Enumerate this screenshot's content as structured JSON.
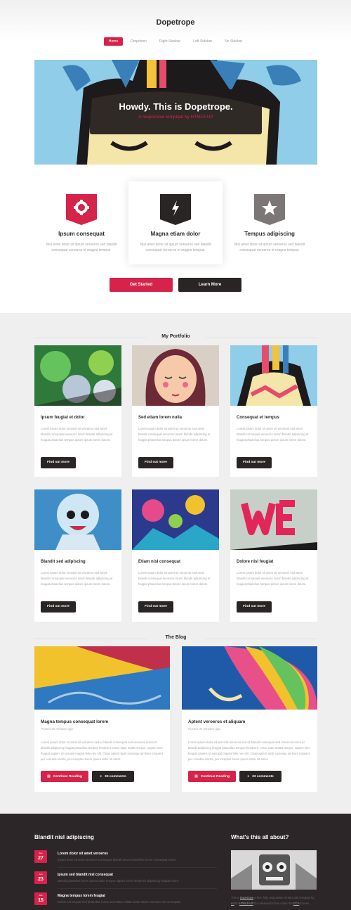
{
  "site": {
    "logo": "Dopetrope"
  },
  "nav": [
    {
      "label": "Home",
      "active": true
    },
    {
      "label": "Dropdown",
      "active": false
    },
    {
      "label": "Right Sidebar",
      "active": false
    },
    {
      "label": "Left Sidebar",
      "active": false
    },
    {
      "label": "No Sidebar",
      "active": false
    }
  ],
  "banner": {
    "title": "Howdy. This is Dopetrope.",
    "subtitle": "A responsive template by HTML5 UP"
  },
  "features": [
    {
      "icon": "gear-icon",
      "color": "#d52349",
      "title": "Ipsum consequat",
      "text": "Nisl amet dolor sit ipsum veroeros sed blandit consequat veroeros et magna tempus."
    },
    {
      "icon": "bolt-icon",
      "color": "#2a2525",
      "title": "Magna etiam dolor",
      "text": "Nisl amet dolor sit ipsum veroeros sed blandit consequat veroeros et magna tempus."
    },
    {
      "icon": "star-icon",
      "color": "#7d7677",
      "title": "Tempus adipiscing",
      "text": "Nisl amet dolor sit ipsum veroeros sed blandit consequat veroeros et magna tempus."
    }
  ],
  "buttons": {
    "primary": "Get Started",
    "secondary": "Learn More"
  },
  "portfolio": {
    "heading": "My Portfolio",
    "items": [
      {
        "title": "Ipsum feugiat et dolor",
        "text": "Lorem ipsum dolor sit amet sit veroeros sed amet blandit consequat veroeros lorem blandit adipiscing et feugiat phasellus tempus dolore ipsum lorem dolore.",
        "button": "Find out more"
      },
      {
        "title": "Sed etiam lorem nulla",
        "text": "Lorem ipsum dolor sit amet sit veroeros sed amet blandit consequat veroeros lorem blandit adipiscing et feugiat phasellus tempus dolore ipsum lorem dolore.",
        "button": "Find out more"
      },
      {
        "title": "Consequat et tempus",
        "text": "Lorem ipsum dolor sit amet sit veroeros sed amet blandit consequat veroeros lorem blandit adipiscing et feugiat phasellus tempus dolore ipsum lorem dolore.",
        "button": "Find out more"
      },
      {
        "title": "Blandit sed adipiscing",
        "text": "Lorem ipsum dolor sit amet sit veroeros sed amet blandit consequat veroeros lorem blandit adipiscing et feugiat phasellus tempus dolore ipsum lorem dolore.",
        "button": "Find out more"
      },
      {
        "title": "Etiam nisl consequat",
        "text": "Lorem ipsum dolor sit amet sit veroeros sed amet blandit consequat veroeros lorem blandit adipiscing et feugiat phasellus tempus dolore ipsum lorem dolore.",
        "button": "Find out more"
      },
      {
        "title": "Dolore nisl feugiat",
        "text": "Lorem ipsum dolor sit amet sit veroeros sed amet blandit consequat veroeros lorem blandit adipiscing et feugiat phasellus tempus dolore ipsum lorem dolore.",
        "button": "Find out more"
      }
    ]
  },
  "blog": {
    "heading": "The Blog",
    "posts": [
      {
        "title": "Magna tempus consequat lorem",
        "meta": "Posted 45 minutes ago",
        "text": "Lorem ipsum dolor sit amet sit veroeros sed et blandit consequat sed veroeros lorem et blandit adipiscing feugiat phasellus tempus hendrerit, tortor vitae mattis tempor, sapien sem feugiat sapien, id suscipit magna felis nec elit. Class aptent taciti sociosqu ad litora torquent per conubia nostra, per inceptos lorem ipsum dolor sit amet.",
        "read": "Continue Reading",
        "comments": "33 comments"
      },
      {
        "title": "Aptent veroeros et aliquam",
        "meta": "Posted 45 minutes ago",
        "text": "Lorem ipsum dolor sit amet sit veroeros sed et blandit consequat sed veroeros lorem et blandit adipiscing feugiat phasellus tempus hendrerit, tortor vitae mattis tempor, sapien sem feugiat sapien, id suscipit magna felis nec elit. Class aptent taciti sociosqu ad litora torquent per conubia nostra, per inceptos lorem ipsum dolor sit amet.",
        "read": "Continue Reading",
        "comments": "33 comments"
      }
    ]
  },
  "footer": {
    "left_title": "Blandit nisl adipiscing",
    "items": [
      {
        "month": "Jan",
        "day": "27",
        "title": "Lorem dolor sit amet veroeros",
        "text": "Ipsum dolor sit amet veroeros consequat blandit ipsum phasellus lorem consequat etiam."
      },
      {
        "month": "Jan",
        "day": "23",
        "title": "Ipsum sed blandit nisl consequat",
        "text": "Blandit phasellus lorem ipsum dolor tempor sapien tortor hendrerit adipiscing feugiat lorem."
      },
      {
        "month": "Jan",
        "day": "15",
        "title": "Magna tempus lorem feugiat",
        "text": "Dolore consequat sed phasellus lorem sed etiam nullam dolor etiam sed amet sit consequat."
      }
    ],
    "right_title": "What's this all about?",
    "about": {
      "pre": "This is ",
      "link1": "Dopetrope",
      "mid1": " a free, fully responsive HTML5 site template by ",
      "link2": "AJ",
      "mid2": " for ",
      "link3": "HTML5 UP",
      "mid3": " It's released for free under the ",
      "link4": "CCA",
      "post": " license."
    }
  }
}
